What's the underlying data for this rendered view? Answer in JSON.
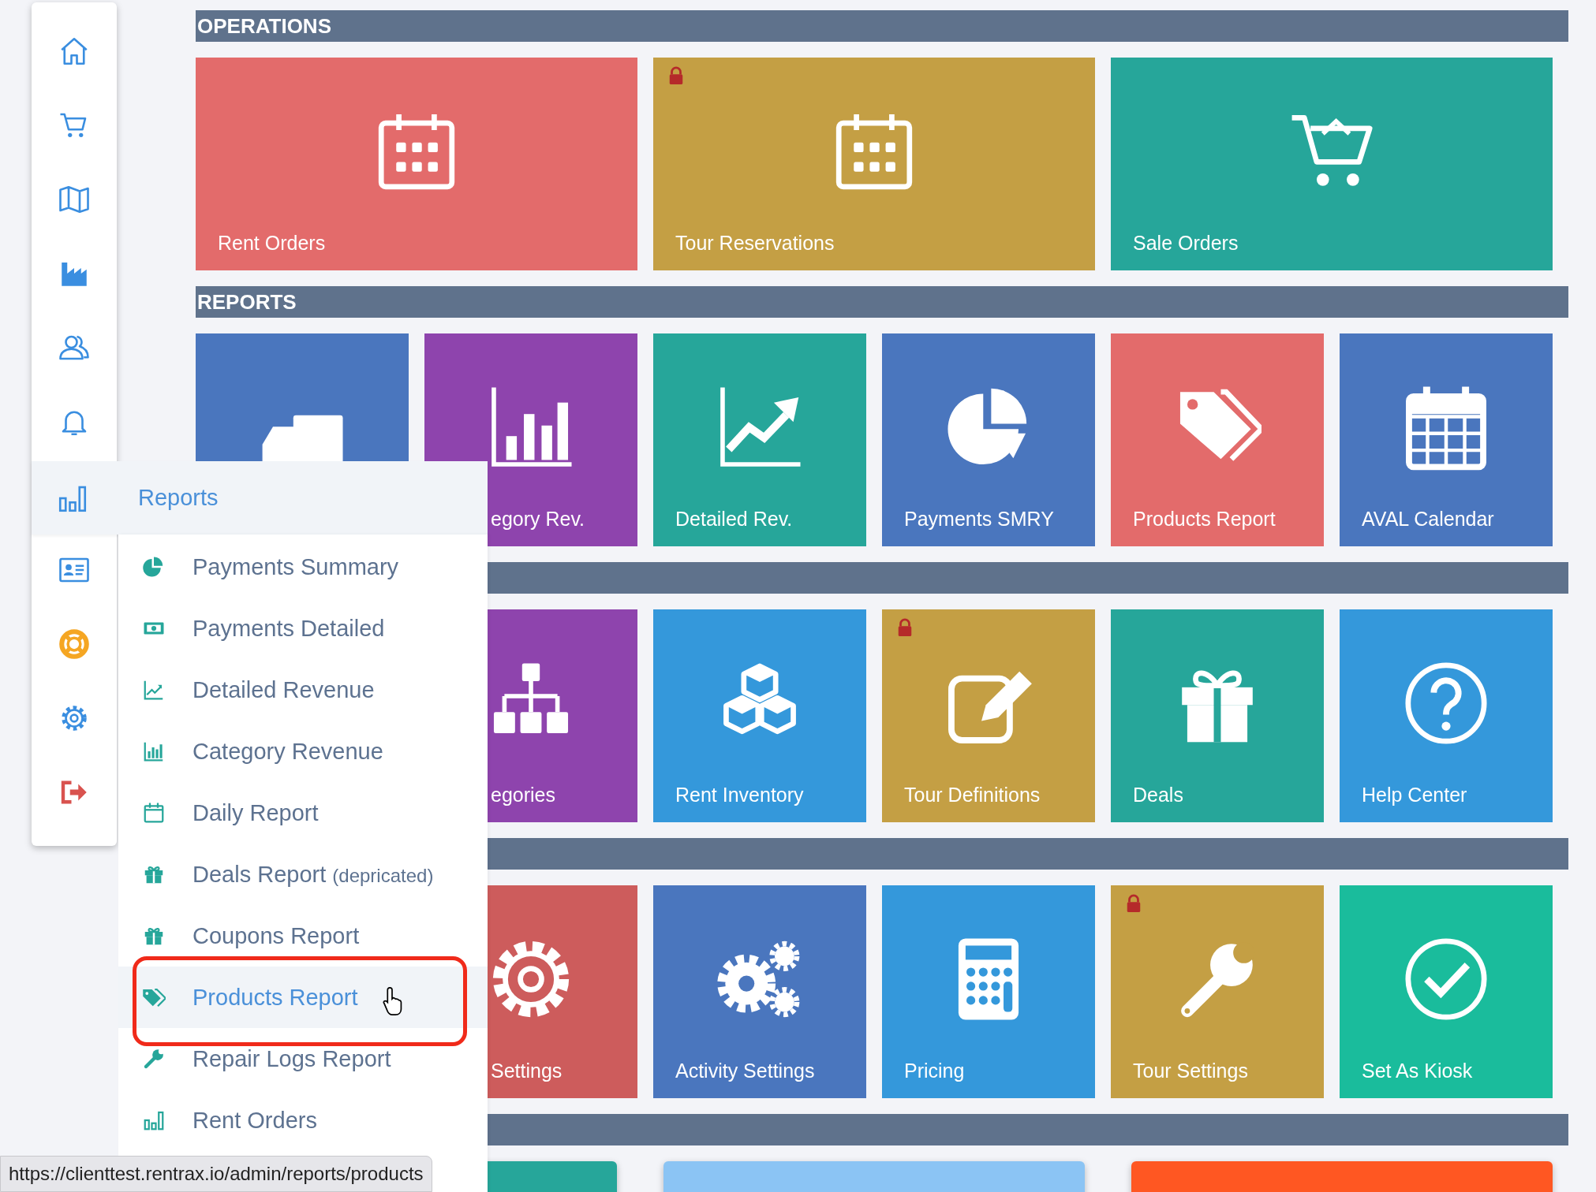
{
  "sections": [
    {
      "kind": "tiles",
      "title": "OPERATIONS",
      "tiles": [
        {
          "label": "Rent Orders",
          "color": "#e36b6b",
          "locked": false
        },
        {
          "label": "Tour Reservations",
          "color": "#c49f44",
          "locked": true
        },
        {
          "label": "Sale Orders",
          "color": "#26a69a",
          "locked": false
        }
      ]
    },
    {
      "kind": "tiles",
      "title": "REPORTS",
      "tiles": [
        {
          "color": "#4a76be",
          "locked": false
        },
        {
          "label": "egory Rev.",
          "color": "#8e44ad",
          "locked": false
        },
        {
          "label": "Detailed Rev.",
          "color": "#26a69a",
          "locked": false
        },
        {
          "label": "Payments SMRY",
          "color": "#4a76be",
          "locked": false
        },
        {
          "label": "Products Report",
          "color": "#e36b6b",
          "locked": false
        },
        {
          "label": "AVAL Calendar",
          "color": "#4a76be",
          "locked": false
        }
      ]
    },
    {
      "kind": "tiles",
      "tiles": [
        {
          "label": "egories",
          "color": "#8e44ad"
        },
        {
          "label": "Rent Inventory",
          "color": "#3498db",
          "locked": false
        },
        {
          "label": "Tour Definitions",
          "color": "#c49f44",
          "locked": true
        },
        {
          "label": "Deals",
          "color": "#26a69a",
          "locked": false
        },
        {
          "label": "Help Center",
          "color": "#3498db",
          "locked": false
        }
      ]
    },
    {
      "kind": "tiles",
      "tiles": [
        {
          "label": "Settings",
          "color": "#cd5c5c"
        },
        {
          "label": "Activity Settings",
          "color": "#4a76be",
          "locked": false
        },
        {
          "label": "Pricing",
          "color": "#3498db",
          "locked": false
        },
        {
          "label": "Tour Settings",
          "color": "#c49f44",
          "locked": true
        },
        {
          "label": "Set As Kiosk",
          "color": "#1abc9c",
          "locked": false
        }
      ]
    },
    {
      "kind": "cards",
      "tiles": [
        {
          "color": "#26a69a"
        },
        {
          "color": "#8bc4f4"
        },
        {
          "color": "#ff5722"
        }
      ]
    }
  ],
  "flyout": {
    "title": "Reports",
    "items": [
      {
        "label": "Payments Summary",
        "selected": false
      },
      {
        "label": "Payments Detailed",
        "selected": false
      },
      {
        "label": "Detailed Revenue",
        "selected": false
      },
      {
        "label": "Category Revenue",
        "selected": false
      },
      {
        "label": "Daily Report",
        "selected": false
      },
      {
        "label": "Deals Report",
        "note": "(depricated)",
        "selected": false
      },
      {
        "label": "Coupons Report",
        "selected": false
      },
      {
        "label": "Products Report",
        "selected": true
      },
      {
        "label": "Repair Logs Report",
        "selected": false
      },
      {
        "label": "Rent Orders",
        "selected": false
      }
    ]
  },
  "status_bar": {
    "url": "https://clienttest.rentrax.io/admin/reports/products"
  }
}
